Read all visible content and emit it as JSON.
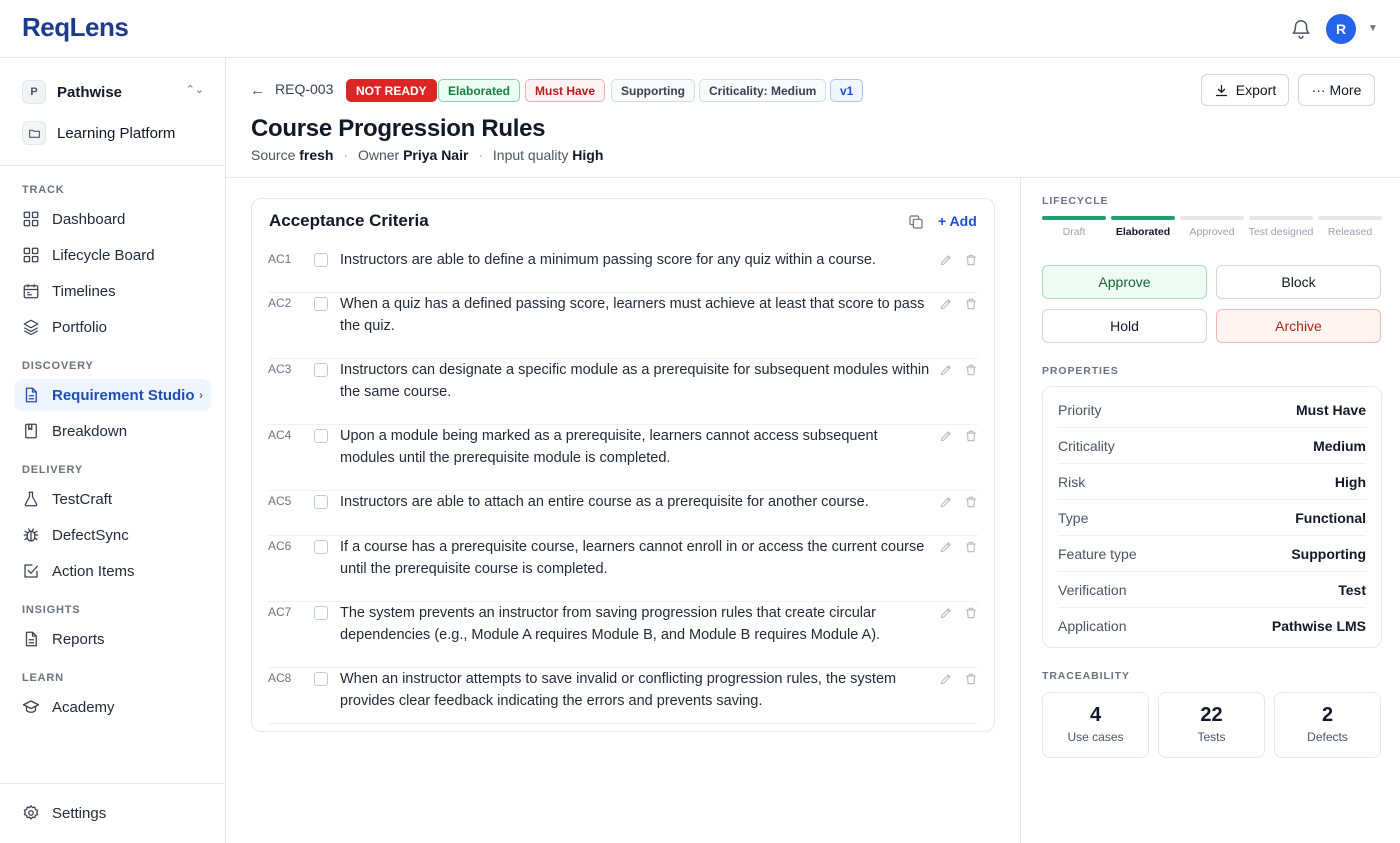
{
  "app": {
    "logo": "ReqLens",
    "avatar_initial": "R"
  },
  "sidebar": {
    "project": {
      "initial": "P",
      "name": "Pathwise",
      "subproject": "Learning Platform"
    },
    "sections": {
      "track": "TRACK",
      "discovery": "DISCOVERY",
      "delivery": "DELIVERY",
      "insights": "INSIGHTS",
      "learn": "LEARN"
    },
    "items": {
      "dashboard": "Dashboard",
      "lifecycle_board": "Lifecycle Board",
      "timelines": "Timelines",
      "portfolio": "Portfolio",
      "requirement_studio": "Requirement Studio",
      "breakdown": "Breakdown",
      "testcraft": "TestCraft",
      "defectsync": "DefectSync",
      "action_items": "Action Items",
      "reports": "Reports",
      "academy": "Academy",
      "settings": "Settings"
    }
  },
  "header": {
    "req_id": "REQ-003",
    "badges": {
      "status": "NOT READY",
      "stage": "Elaborated",
      "priority": "Must Have",
      "feature_type": "Supporting",
      "criticality": "Criticality: Medium",
      "version": "v1"
    },
    "title": "Course Progression Rules",
    "meta": {
      "source_label": "Source",
      "source_value": "fresh",
      "owner_label": "Owner",
      "owner_value": "Priya Nair",
      "quality_label": "Input quality",
      "quality_value": "High"
    },
    "export_label": "Export",
    "more_label": "··· More"
  },
  "acceptance": {
    "title": "Acceptance Criteria",
    "add_label": "+ Add",
    "items": [
      {
        "id": "AC1",
        "text": "Instructors are able to define a minimum passing score for any quiz within a course."
      },
      {
        "id": "AC2",
        "text": "When a quiz has a defined passing score, learners must achieve at least that score to pass the quiz."
      },
      {
        "id": "AC3",
        "text": "Instructors can designate a specific module as a prerequisite for subsequent modules within the same course."
      },
      {
        "id": "AC4",
        "text": "Upon a module being marked as a prerequisite, learners cannot access subsequent modules until the prerequisite module is completed."
      },
      {
        "id": "AC5",
        "text": "Instructors are able to attach an entire course as a prerequisite for another course."
      },
      {
        "id": "AC6",
        "text": "If a course has a prerequisite course, learners cannot enroll in or access the current course until the prerequisite course is completed."
      },
      {
        "id": "AC7",
        "text": "The system prevents an instructor from saving progression rules that create circular dependencies (e.g., Module A requires Module B, and Module B requires Module A)."
      },
      {
        "id": "AC8",
        "text": "When an instructor attempts to save invalid or conflicting progression rules, the system provides clear feedback indicating the errors and prevents saving."
      }
    ]
  },
  "lifecycle": {
    "label": "LIFECYCLE",
    "current_stage": "Elaborated",
    "stages": [
      "Draft",
      "Elaborated",
      "Approved",
      "Test designed",
      "Released"
    ],
    "accent_color": "#22a06b"
  },
  "actions": {
    "approve": "Approve",
    "block": "Block",
    "hold": "Hold",
    "archive": "Archive"
  },
  "properties": {
    "label": "PROPERTIES",
    "rows": [
      {
        "key": "Priority",
        "value": "Must Have"
      },
      {
        "key": "Criticality",
        "value": "Medium"
      },
      {
        "key": "Risk",
        "value": "High"
      },
      {
        "key": "Type",
        "value": "Functional"
      },
      {
        "key": "Feature type",
        "value": "Supporting"
      },
      {
        "key": "Verification",
        "value": "Test"
      },
      {
        "key": "Application",
        "value": "Pathwise LMS"
      }
    ]
  },
  "traceability": {
    "label": "TRACEABILITY",
    "use_cases": {
      "count": "4",
      "label": "Use cases"
    },
    "tests": {
      "count": "22",
      "label": "Tests"
    },
    "defects": {
      "count": "2",
      "label": "Defects"
    }
  }
}
